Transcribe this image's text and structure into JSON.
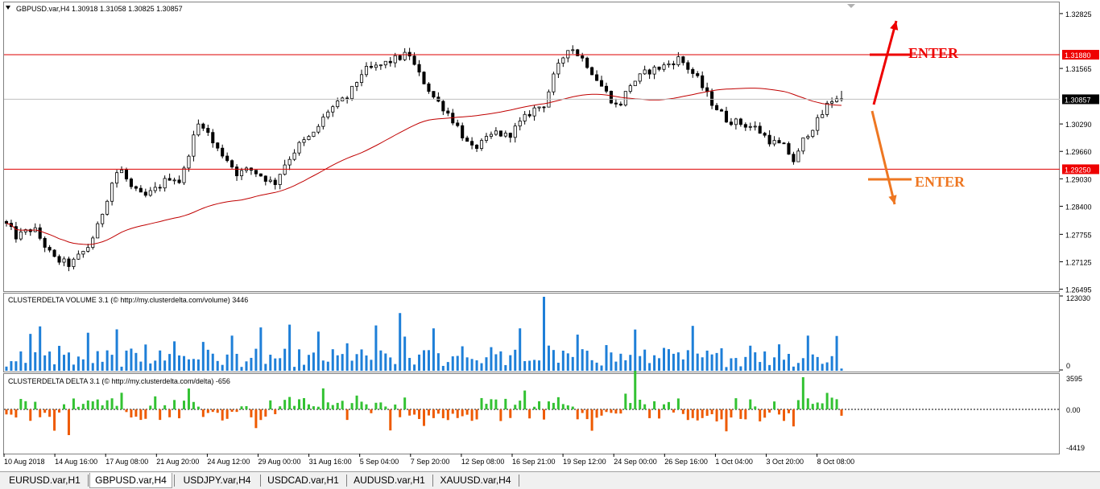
{
  "window": {
    "title": "GBPUSD.var,H4  1.30918 1.31058 1.30825 1.30857"
  },
  "tabs": [
    {
      "label": "EURUSD.var,H1",
      "active": false
    },
    {
      "label": "GBPUSD.var,H4",
      "active": true
    },
    {
      "label": "USDJPY.var,H4",
      "active": false
    },
    {
      "label": "USDCAD.var,H1",
      "active": false
    },
    {
      "label": "AUDUSD.var,H1",
      "active": false
    },
    {
      "label": "XAUUSD.var,H4",
      "active": false
    }
  ],
  "colors": {
    "bull": "#000000",
    "ma": "#c00000",
    "level_line": "#dd0000",
    "level_box": "#ee0000",
    "current_box": "#000000",
    "volume": "#1e7fd8",
    "delta_up": "#33c233",
    "delta_down": "#ee5a00",
    "arrow_up": "#ee0000",
    "arrow_down": "#ee7722",
    "grid": "#a0a0a0"
  },
  "chart_data": [
    {
      "type": "candlestick",
      "symbol": "GBPUSD.var",
      "timeframe": "H4",
      "title": "GBPUSD.var,H4  1.30918 1.31058 1.30825 1.30857",
      "ylim": [
        1.2645,
        1.331
      ],
      "y_ticks": [
        "1.32825",
        "1.31565",
        "1.30290",
        "1.29660",
        "1.29030",
        "1.28400",
        "1.27755",
        "1.27125",
        "1.26495"
      ],
      "x_labels": [
        "10 Aug 2018",
        "14 Aug 16:00",
        "17 Aug 08:00",
        "21 Aug 20:00",
        "24 Aug 12:00",
        "29 Aug 00:00",
        "31 Aug 16:00",
        "5 Sep 04:00",
        "7 Sep 20:00",
        "12 Sep 08:00",
        "16 Sep 21:00",
        "19 Sep 12:00",
        "24 Sep 00:00",
        "26 Sep 16:00",
        "1 Oct 04:00",
        "3 Oct 20:00",
        "8 Oct 08:00"
      ],
      "candle_count": 175,
      "anchors": [
        [
          0,
          1.2805
        ],
        [
          5,
          1.277
        ],
        [
          12,
          1.279
        ],
        [
          20,
          1.272
        ],
        [
          27,
          1.2705
        ],
        [
          34,
          1.2745
        ],
        [
          38,
          1.279
        ],
        [
          44,
          1.2895
        ],
        [
          47,
          1.293
        ],
        [
          52,
          1.288
        ],
        [
          57,
          1.286
        ],
        [
          62,
          1.288
        ],
        [
          68,
          1.291
        ],
        [
          72,
          1.2895
        ],
        [
          76,
          1.298
        ],
        [
          80,
          1.304
        ],
        [
          86,
          1.2975
        ],
        [
          90,
          1.2955
        ],
        [
          95,
          1.2915
        ],
        [
          100,
          1.2925
        ],
        [
          105,
          1.291
        ],
        [
          110,
          1.289
        ],
        [
          114,
          1.2935
        ],
        [
          120,
          1.298
        ],
        [
          126,
          1.3005
        ],
        [
          132,
          1.306
        ],
        [
          140,
          1.309
        ],
        [
          146,
          1.315
        ],
        [
          152,
          1.316
        ],
        [
          158,
          1.3175
        ],
        [
          165,
          1.319
        ],
        [
          168,
          1.315
        ],
        [
          170,
          1.3135
        ],
        [
          175,
          1.309
        ],
        [
          180,
          1.306
        ],
        [
          185,
          1.302
        ],
        [
          190,
          1.297
        ],
        [
          195,
          1.2985
        ],
        [
          200,
          1.301
        ],
        [
          205,
          1.3
        ],
        [
          210,
          1.303
        ],
        [
          215,
          1.306
        ],
        [
          220,
          1.3075
        ],
        [
          224,
          1.314
        ],
        [
          230,
          1.321
        ],
        [
          237,
          1.317
        ],
        [
          244,
          1.311
        ],
        [
          250,
          1.3065
        ],
        [
          255,
          1.312
        ],
        [
          262,
          1.315
        ],
        [
          268,
          1.316
        ],
        [
          275,
          1.318
        ],
        [
          282,
          1.3135
        ],
        [
          288,
          1.308
        ],
        [
          294,
          1.304
        ],
        [
          300,
          1.303
        ],
        [
          306,
          1.302
        ],
        [
          312,
          1.299
        ],
        [
          318,
          1.2975
        ],
        [
          322,
          1.294
        ],
        [
          326,
          1.3
        ],
        [
          332,
          1.304
        ],
        [
          336,
          1.308
        ],
        [
          342,
          1.31
        ]
      ],
      "ma_period": 50,
      "levels": [
        {
          "value": 1.3188,
          "label": "1.31880"
        },
        {
          "value": 1.2925,
          "label": "1.29250"
        }
      ],
      "current_price": {
        "value": 1.30857,
        "label": "1.30857"
      },
      "annotations": [
        {
          "text": "ENTER",
          "direction": "up",
          "color": "#ee0000"
        },
        {
          "text": "ENTER",
          "direction": "down",
          "color": "#ee7722"
        }
      ]
    },
    {
      "type": "bar",
      "title": "CLUSTERDELTA VOLUME 3.1 (© http://my.clusterdelta.com/volume) 3446",
      "ylim": [
        0,
        123030
      ],
      "y_ticks": [
        "123030",
        "0"
      ],
      "last_value": 3446
    },
    {
      "type": "bar",
      "title": "CLUSTERDELTA DELTA 3.1 (© http://my.clusterdelta.com/delta) -656",
      "ylim": [
        -4419,
        3595
      ],
      "y_ticks": [
        "3595",
        "0.00",
        "-4419"
      ],
      "last_value": -656
    }
  ]
}
